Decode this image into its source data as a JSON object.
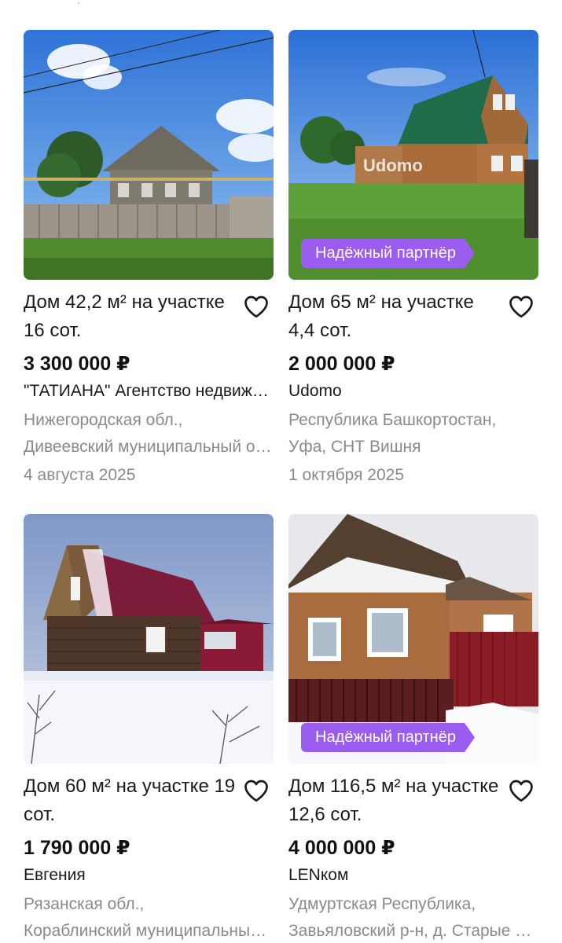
{
  "listings": [
    {
      "title": "Дом 42,2 м² на участке 16 сот.",
      "price": "3 300 000 ₽",
      "seller": "\"ТАТИАНА\" Агентство недвижимости",
      "address_line1": "Нижегородская обл.,",
      "address_line2": "Дивеевский муниципальный округ",
      "date": "4 августа 2025",
      "badge": ""
    },
    {
      "title": "Дом 65 м² на участке 4,4 сот.",
      "price": "2 000 000 ₽",
      "seller": "Udomo",
      "address_line1": "Республика Башкортостан,",
      "address_line2": "Уфа, СНТ Вишня",
      "date": "1 октября 2025",
      "badge": "Надёжный партнёр",
      "watermark": "Udomo"
    },
    {
      "title": "Дом 60 м² на участке 19 сот.",
      "price": "1 790 000 ₽",
      "seller": "Евгения",
      "address_line1": "Рязанская обл.,",
      "address_line2": "Кораблинский муниципальный округ",
      "date": "",
      "badge": ""
    },
    {
      "title": "Дом 116,5 м² на участке 12,6 сот.",
      "price": "4 000 000 ₽",
      "seller": "LENком",
      "address_line1": "Удмуртская Республика,",
      "address_line2": "Завьяловский р-н, д. Старые Кены",
      "date": "",
      "badge": "Надёжный партнёр"
    }
  ],
  "colors": {
    "badge": "#9b5cf0",
    "secondary_text": "#8a8a8a",
    "primary_text": "#1a1a1a"
  },
  "icons": {
    "favorite": "heart-outline-icon"
  }
}
